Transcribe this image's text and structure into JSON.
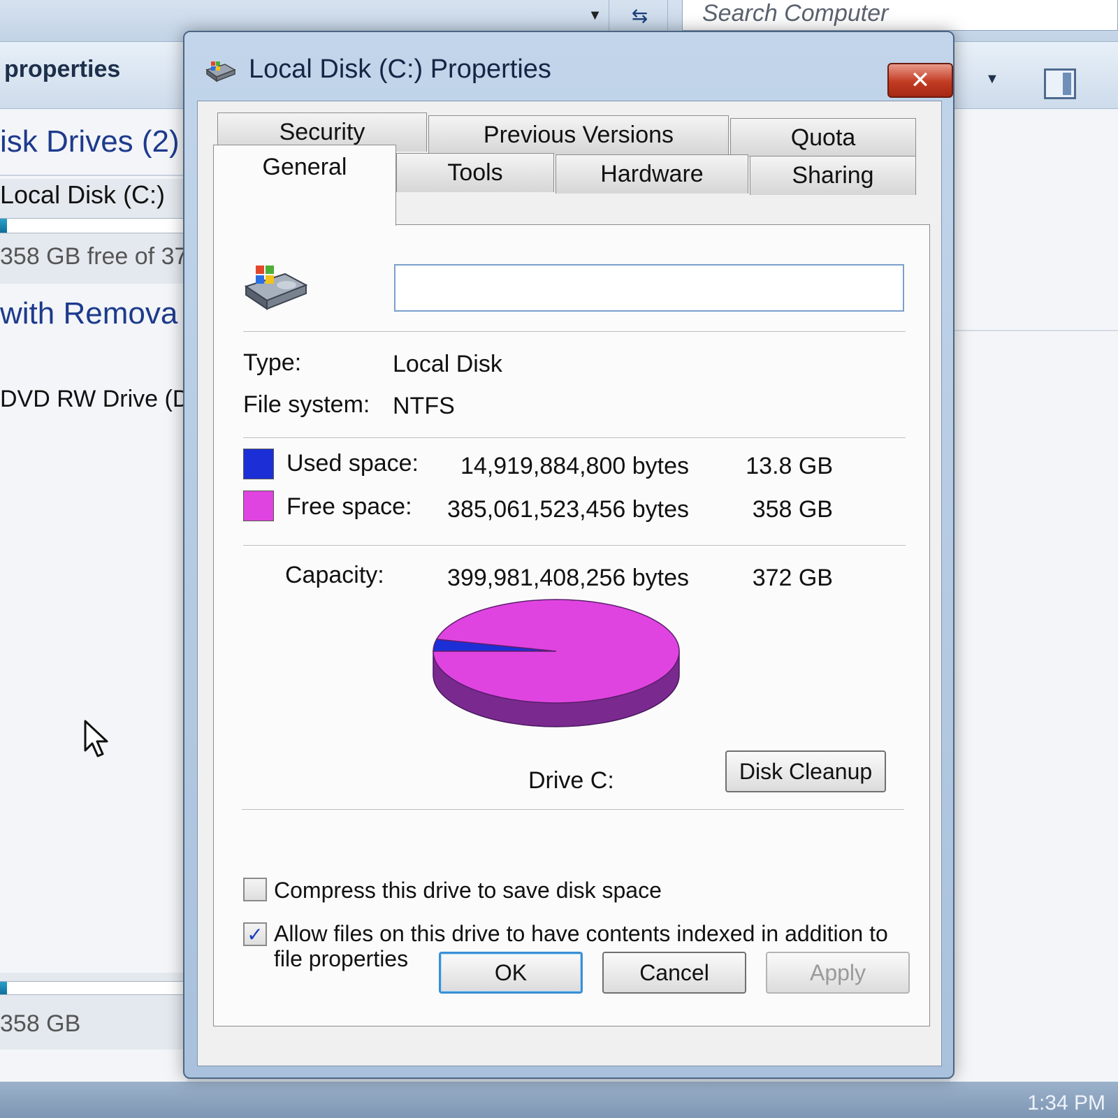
{
  "explorer": {
    "search_placeholder": "Search Computer",
    "toolbar_item": "properties",
    "hdd_group": "isk Drives (2)",
    "drive_c_name": "Local Disk (C:)",
    "drive_c_free": "358 GB free of 37",
    "removable_group": "with Remova",
    "dvd_name": "DVD RW Drive (D",
    "second_tile_free": "358 GB",
    "clock": "1:34 PM",
    "icons": [
      "chevron-down-icon",
      "refresh-icon",
      "preview-pane-icon",
      "mouse-cursor-icon"
    ]
  },
  "dialog": {
    "title": "Local Disk (C:) Properties",
    "close_label": "✕",
    "tabs_row1": [
      "Security",
      "Previous Versions",
      "Quota"
    ],
    "tabs_row2": [
      "General",
      "Tools",
      "Hardware",
      "Sharing"
    ],
    "active_tab": "General",
    "label_value": "",
    "type_label": "Type:",
    "type_value": "Local Disk",
    "fs_label": "File system:",
    "fs_value": "NTFS",
    "used_label": "Used space:",
    "used_bytes": "14,919,884,800 bytes",
    "used_gb": "13.8 GB",
    "free_label": "Free space:",
    "free_bytes": "385,061,523,456 bytes",
    "free_gb": "358 GB",
    "capacity_label": "Capacity:",
    "capacity_bytes": "399,981,408,256 bytes",
    "capacity_gb": "372 GB",
    "drive_caption": "Drive C:",
    "disk_cleanup_label": "Disk Cleanup",
    "compress_label": "Compress this drive to save disk space",
    "compress_checked": false,
    "index_label": "Allow files on this drive to have contents indexed in addition to file properties",
    "index_checked": true,
    "ok_label": "OK",
    "cancel_label": "Cancel",
    "apply_label": "Apply",
    "colors": {
      "used": "#1c2fd6",
      "free": "#e044e0",
      "used_side": "#1a1f8a",
      "free_side": "#7a2a8e"
    }
  },
  "chart_data": {
    "type": "pie",
    "categories": [
      "Used space",
      "Free space"
    ],
    "values": [
      14919884800,
      385061523456
    ]
  }
}
